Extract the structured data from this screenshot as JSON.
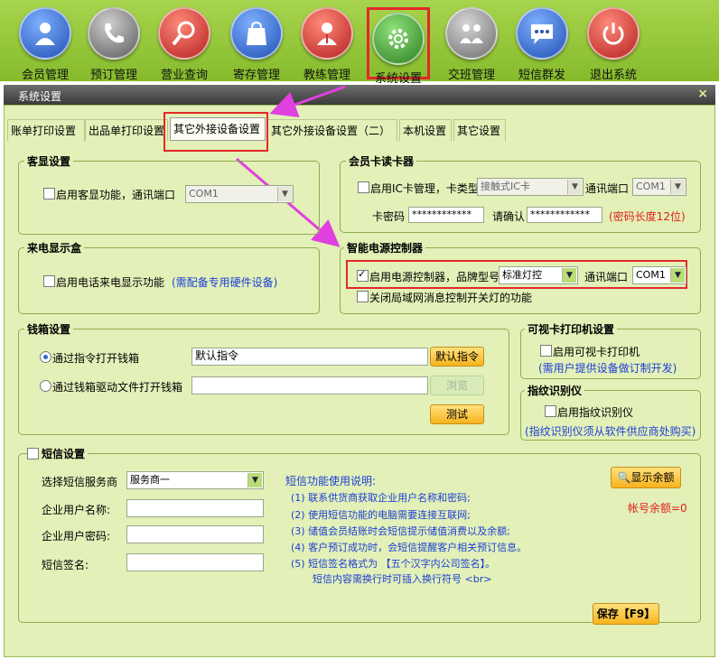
{
  "toolbar": {
    "items": [
      {
        "label": "会员管理",
        "icon": "member-icon",
        "color": "#2c62c4"
      },
      {
        "label": "预订管理",
        "icon": "phone-icon",
        "color": "#6a6a6a"
      },
      {
        "label": "营业查询",
        "icon": "search-icon",
        "color": "#d2322f"
      },
      {
        "label": "寄存管理",
        "icon": "bag-icon",
        "color": "#2a55b8"
      },
      {
        "label": "教练管理",
        "icon": "coach-icon",
        "color": "#d2322f"
      },
      {
        "label": "系统设置",
        "icon": "gear-icon",
        "color": "#3b8f2d"
      },
      {
        "label": "交班管理",
        "icon": "shift-icon",
        "color": "#7a7a7a"
      },
      {
        "label": "短信群发",
        "icon": "sms-icon",
        "color": "#2a55b8"
      },
      {
        "label": "退出系统",
        "icon": "power-icon",
        "color": "#d2322f"
      }
    ]
  },
  "dialog": {
    "title": "系统设置",
    "close": "×"
  },
  "tabs": [
    "账单打印设置",
    "出品单打印设置",
    "其它外接设备设置",
    "其它外接设备设置（二）",
    "本机设置",
    "其它设置"
  ],
  "customer_display": {
    "title": "客显设置",
    "enable_label": "启用客显功能，通讯端口",
    "port": "COM1"
  },
  "caller_id": {
    "title": "来电显示盒",
    "enable_label": "启用电话来电显示功能",
    "note": "(需配备专用硬件设备)"
  },
  "card_reader": {
    "title": "会员卡读卡器",
    "enable_label": "启用IC卡管理，卡类型",
    "card_type": "接触式IC卡",
    "port_label": "通讯端口",
    "port": "COM1",
    "password_label": "卡密码",
    "password": "************",
    "confirm_label": "请确认",
    "confirm": "************",
    "password_note": "(密码长度12位)"
  },
  "power_controller": {
    "title": "智能电源控制器",
    "enable_label": "启用电源控制器，品牌型号",
    "model": "标准灯控",
    "port_label": "通讯端口",
    "port": "COM1",
    "lan_label": "关闭局域网消息控制开关灯的功能"
  },
  "cash_drawer": {
    "title": "钱箱设置",
    "option1": "通过指令打开钱箱",
    "command": "默认指令",
    "default_btn": "默认指令",
    "option2": "通过钱箱驱动文件打开钱箱",
    "browse_btn": "浏览",
    "test_btn": "测试"
  },
  "visual_card_printer": {
    "title": "可视卡打印机设置",
    "enable_label": "启用可视卡打印机",
    "note": "(需用户提供设备做订制开发)"
  },
  "fingerprint": {
    "title": "指纹识别仪",
    "enable_label": "启用指纹识别仪",
    "note": "(指纹识别仪须从软件供应商处购买)"
  },
  "sms": {
    "title": "短信设置",
    "provider_label": "选择短信服务商",
    "provider": "服务商一",
    "user_label": "企业用户名称:",
    "password_label": "企业用户密码:",
    "signature_label": "短信签名:",
    "help_title": "短信功能使用说明:",
    "help_lines": [
      "(1) 联系供货商获取企业用户名称和密码;",
      "(2) 使用短信功能的电脑需要连接互联网;",
      "(3) 储值会员结账时会短信提示储值消费以及余额;",
      "(4) 客户预订成功时，会短信提醒客户相关预订信息。",
      "(5) 短信签名格式为 【五个汉字内公司签名】。",
      "短信内容需换行时可插入换行符号 <br>"
    ],
    "balance_btn": "显示余额",
    "balance_text": "帐号余额=0"
  },
  "save_btn": "保存【F9】"
}
